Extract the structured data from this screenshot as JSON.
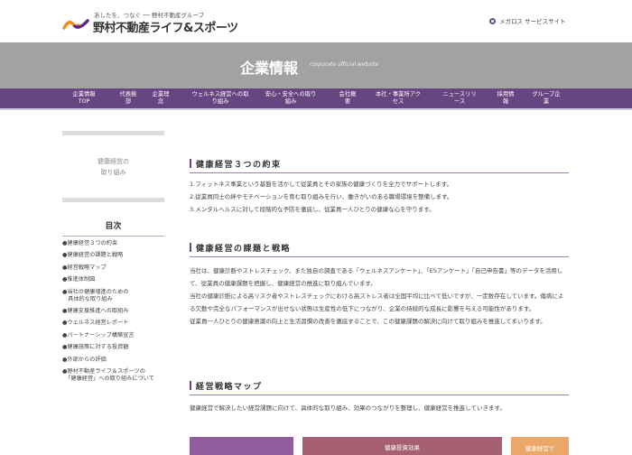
{
  "header": {
    "tagline": "あしたを、つなぐ ── 野村不動産グループ",
    "logo_text": "野村不動産ライフ&スポーツ",
    "service_link": "メガロス サービスサイト"
  },
  "banner": {
    "title": "企業情報",
    "subtitle": "corporate official website"
  },
  "nav": [
    "企業情報\nTOP",
    "代表挨\n拶",
    "企業理\n念",
    "ウェルネス経営への取\nり組み",
    "安心・安全への取り\n組み",
    "会社概\n要",
    "本社・事業所アク\nセス",
    "ニュースリリ\nース",
    "採用情\n報",
    "グループ企\n業"
  ],
  "sidebar": {
    "title": "健康経営の\n取り組み",
    "toc_title": "目次",
    "toc": [
      "●健康経営３つの約束",
      "●健康経営の課題と戦略",
      "●経営戦略マップ",
      "●推進体制図",
      "●当社の健康増進のための\n　具体的な取り組み",
      "●健康支援推進への取組み",
      "●ウェルネス経営レポート",
      "●パートナーシップ構築宣言",
      "●健康施策に対する投資額",
      "●外部からの評価",
      "●野村不動産ライフ＆スポーツの\n　「健康経営」への取り組みについて"
    ]
  },
  "main": {
    "s1_title": "健康経営３つの約束",
    "promises": [
      "1.フィットネス事業という基盤を活かして従業員とその家族の健康づくりを全力でサポートします。",
      "2.従業員同士の絆やモチベーションを育む取り組みを行い、働きがいのある職場環境を整備します。",
      "3.メンタルヘルスに対して段階的な予防を徹底し、従業員一人ひとりの健康な心を守ります。"
    ],
    "s2_title": "健康経営の課題と戦略",
    "s2_paras": [
      "当社は、健康診断やストレスチェック、また独自の調査である「ウェルネスアンケート」、「ESアンケート」「自己申告書」等のデータを活用して、従業員の健康課題を把握し、健康経営の推進に取り組んでいます。",
      "当社の健康診断による高リスク者やストレスチェックにおける高ストレス者は全国平均に比べて低いですが、一定数存在しています。傷病による欠勤や完全なパフォーマンスが出せない状態は生産性の低下につながり、企業の持続的な成長に影響を与える可能性があります。",
      "従業員一人ひとりの健康意識の向上と生活習慣の改善を徹底することで、この健康課題の解決に向けて取り組みを推進してまいります。"
    ],
    "s3_title": "経営戦略マップ",
    "s3_para": "健康経営で解決したい経営課題に向けて、具体的な取り組み、効果のつながりを整理し、健康経営を推進していきます。",
    "map_boxes": [
      "",
      "健康投資効果",
      "健康経営で"
    ]
  },
  "colors": {
    "purple": "#664680",
    "banner": "#a2a2a2",
    "box1": "#925d9c",
    "box2": "#a66073",
    "box3": "#eba767"
  }
}
